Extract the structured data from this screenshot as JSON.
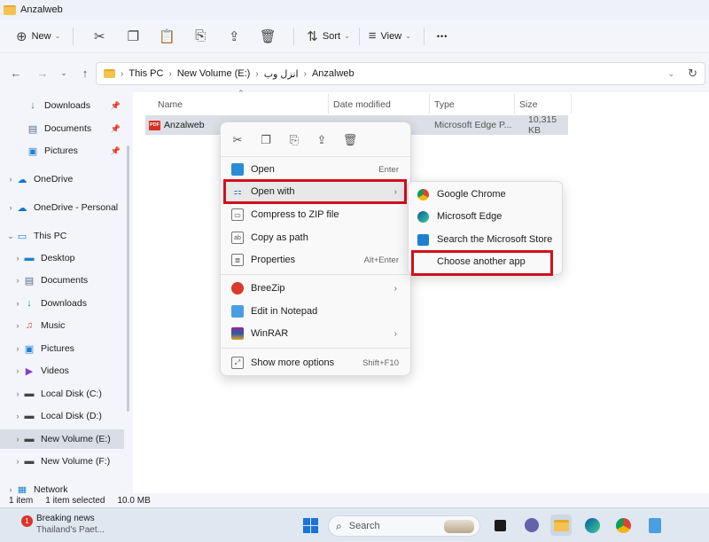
{
  "window": {
    "title": "Anzalweb"
  },
  "toolbar": {
    "new_label": "New",
    "sort_label": "Sort",
    "view_label": "View",
    "more_label": "•••"
  },
  "address": {
    "crumbs": [
      "This PC",
      "New Volume (E:)",
      "انزل وب",
      "Anzalweb"
    ]
  },
  "sidebar": {
    "items": [
      {
        "label": "Downloads",
        "icon": "download-icon"
      },
      {
        "label": "Documents",
        "icon": "documents-icon"
      },
      {
        "label": "Pictures",
        "icon": "pictures-icon"
      },
      {
        "label": "OneDrive",
        "icon": "onedrive-icon"
      },
      {
        "label": "OneDrive - Personal",
        "icon": "onedrive-icon"
      },
      {
        "label": "This PC",
        "icon": "pc-icon"
      },
      {
        "label": "Desktop",
        "icon": "desktop-icon"
      },
      {
        "label": "Documents",
        "icon": "documents-icon"
      },
      {
        "label": "Downloads",
        "icon": "download-icon"
      },
      {
        "label": "Music",
        "icon": "music-icon"
      },
      {
        "label": "Pictures",
        "icon": "pictures-icon"
      },
      {
        "label": "Videos",
        "icon": "videos-icon"
      },
      {
        "label": "Local Disk (C:)",
        "icon": "drive-icon"
      },
      {
        "label": "Local Disk (D:)",
        "icon": "drive-icon"
      },
      {
        "label": "New Volume (E:)",
        "icon": "drive-icon"
      },
      {
        "label": "New Volume (F:)",
        "icon": "drive-icon"
      },
      {
        "label": "Network",
        "icon": "network-icon"
      }
    ]
  },
  "columns": {
    "name": "Name",
    "date": "Date modified",
    "type": "Type",
    "size": "Size"
  },
  "file": {
    "icon_text": "PDF",
    "name": "Anzalweb",
    "type": "Microsoft Edge P...",
    "size": "10,315 KB"
  },
  "context_menu": {
    "open": "Open",
    "open_sc": "Enter",
    "open_with": "Open with",
    "compress": "Compress to ZIP file",
    "copy_path": "Copy as path",
    "properties": "Properties",
    "properties_sc": "Alt+Enter",
    "breezip": "BreeZip",
    "notepad": "Edit in Notepad",
    "winrar": "WinRAR",
    "more": "Show more options",
    "more_sc": "Shift+F10"
  },
  "submenu": {
    "chrome": "Google Chrome",
    "edge": "Microsoft Edge",
    "store": "Search the Microsoft Store",
    "another": "Choose another app"
  },
  "status": {
    "count": "1 item",
    "selected": "1 item selected",
    "size": "10.0 MB"
  },
  "taskbar": {
    "badge": "1",
    "news_title": "Breaking news",
    "news_sub": "Thailand's Paet...",
    "search": "Search"
  }
}
